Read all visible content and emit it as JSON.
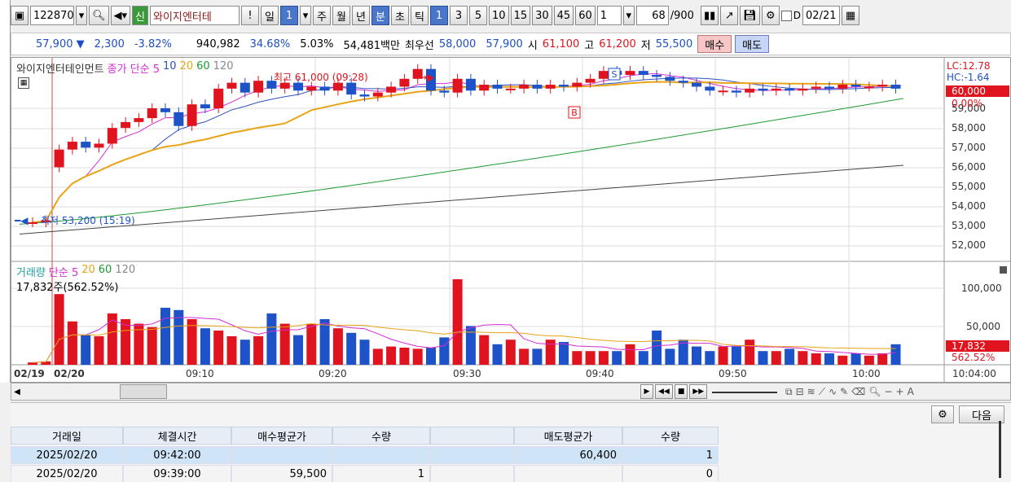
{
  "toolbar": {
    "code": "122870",
    "name_badge": "신",
    "stock_name": "와이지엔터테",
    "alert": "!",
    "period_day": "일",
    "period_num": "1",
    "periods": [
      "주",
      "월",
      "년",
      "분",
      "초",
      "틱"
    ],
    "intervals": [
      "1",
      "3",
      "5",
      "10",
      "15",
      "30",
      "45",
      "60"
    ],
    "interval_value": "1",
    "count_value": "68",
    "count_total": "/900",
    "d_label": "D",
    "date_value": "02/21"
  },
  "info": {
    "price": "57,900",
    "change": "2,300",
    "change_rate": "-3.82%",
    "volume": "940,982",
    "turnover_pct": "34.68%",
    "other_pct": "5.03%",
    "amount": "54,481백만",
    "best_label": "최우선",
    "best_ask": "58,000",
    "best_bid": "57,900",
    "open_label": "시",
    "open": "61,100",
    "high_label": "고",
    "high": "61,200",
    "low_label": "저",
    "low": "55,500",
    "buy_label": "매수",
    "sell_label": "매도"
  },
  "chart": {
    "stock_title": "와이지엔터테인먼트",
    "price_legend": [
      "종가 단순 5",
      "10",
      "20",
      "60",
      "120"
    ],
    "high_note": "최고 61,000 (09:28)",
    "low_note": "최저 53,200 (15:19)",
    "lc": "LC:12.78",
    "hc": "HC:-1.64",
    "current_price": "60,000",
    "current_pct": "0.00%",
    "price_ticks": [
      "59,000",
      "58,000",
      "57,000",
      "56,000",
      "55,000",
      "54,000",
      "53,000",
      "52,000"
    ],
    "vol_legend": [
      "거래량",
      "단순 5",
      "20",
      "60",
      "120"
    ],
    "vol_sub": "17,832주(562.52%)",
    "vol_ticks": [
      "100,000",
      "50,000"
    ],
    "vol_current": "17,832",
    "vol_pct": "562.52%",
    "time_labels": [
      "02/19",
      "02/20",
      "09:10",
      "09:20",
      "09:30",
      "09:40",
      "09:50",
      "10:00",
      "10:04:00"
    ],
    "marker_s": "S",
    "marker_b": "B"
  },
  "colors": {
    "up": "#e0141e",
    "down": "#1d52c9",
    "ma5": "#d42ed4",
    "ma10": "#3050c0",
    "ma20": "#e8a317",
    "ma60": "#1e9a32",
    "ma120": "#444444"
  },
  "panel": {
    "next_label": "다음",
    "headers": [
      "거래일",
      "체결시간",
      "매수평균가",
      "수량",
      "",
      "매도평균가",
      "수량"
    ],
    "rows": [
      [
        "2025/02/20",
        "09:42:00",
        "",
        "",
        "",
        "60,400",
        "1"
      ],
      [
        "2025/02/20",
        "09:39:00",
        "59,500",
        "1",
        "",
        "",
        "0"
      ]
    ]
  }
}
